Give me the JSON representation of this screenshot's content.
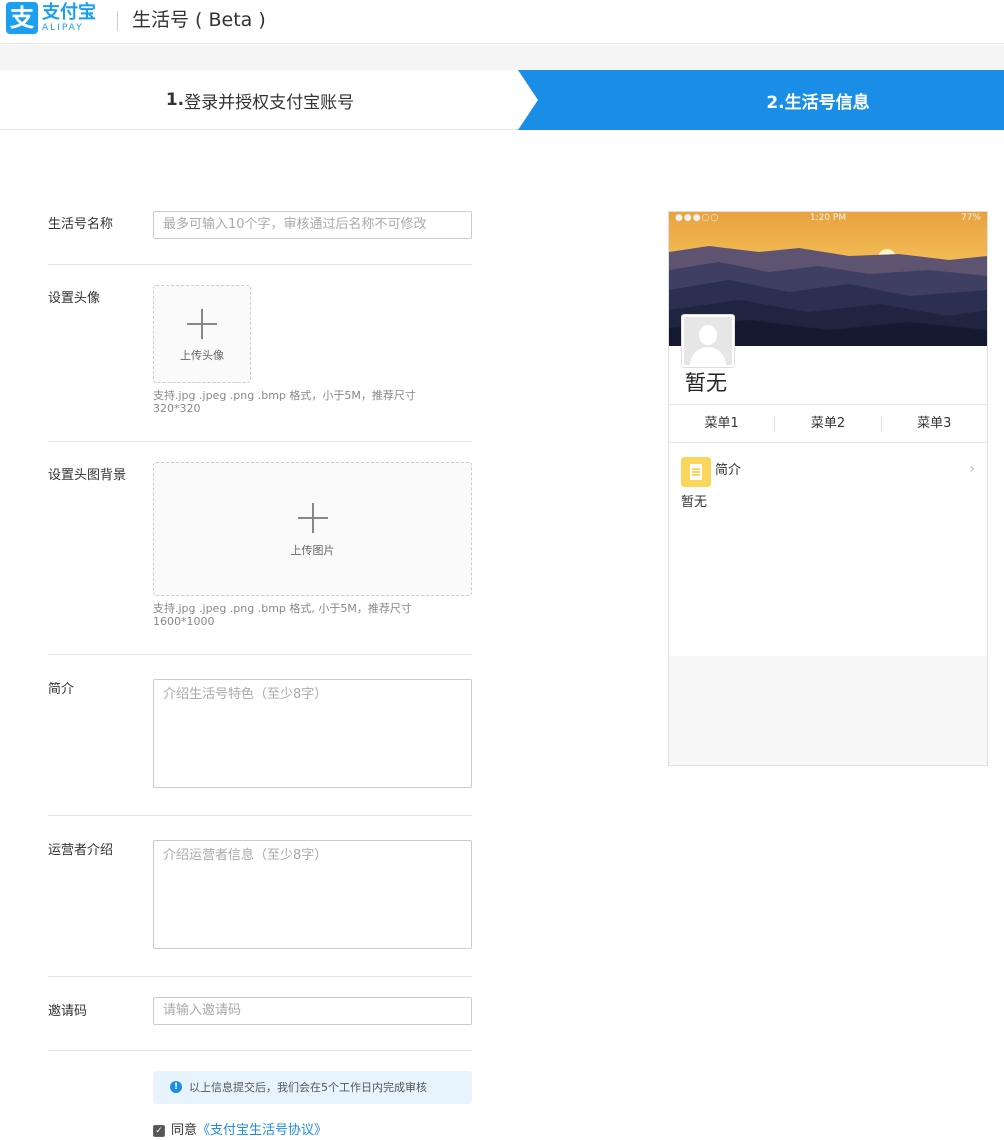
{
  "header": {
    "logo_cn": "支付宝",
    "logo_en": "ALIPAY",
    "logo_glyph": "支",
    "title": "生活号 ( Beta )"
  },
  "steps": {
    "step1_num": "1.",
    "step1_label": "登录并授权支付宝账号",
    "step2_label": "2.生活号信息"
  },
  "form": {
    "name_label": "生活号名称",
    "name_placeholder": "最多可输入10个字，审核通过后名称不可修改",
    "avatar_label": "设置头像",
    "avatar_upload": "上传头像",
    "avatar_hint": "支持.jpg .jpeg .png .bmp 格式，小于5M，推荐尺寸320*320",
    "bg_label": "设置头图背景",
    "bg_upload": "上传图片",
    "bg_hint": "支持.jpg .jpeg .png .bmp 格式, 小于5M，推荐尺寸1600*1000",
    "intro_label": "简介",
    "intro_placeholder": "介绍生活号特色（至少8字）",
    "operator_label": "运营者介绍",
    "operator_placeholder": "介绍运营者信息（至少8字）",
    "invite_label": "邀请码",
    "invite_placeholder": "请输入邀请码",
    "notice": "以上信息提交后，我们会在5个工作日内完成审核",
    "agree_prefix": "同意",
    "agree_link": "《支付宝生活号协议》"
  },
  "preview": {
    "status_signal": "●●●○○",
    "status_time": "1:20 PM",
    "status_battery": "77%",
    "name": "暂无",
    "menus": [
      "菜单1",
      "菜单2",
      "菜单3"
    ],
    "intro_title": "简介",
    "intro_text": "暂无"
  },
  "colors": {
    "brand": "#1a9ff1",
    "step_active": "#1a8ee6",
    "notice_bg": "#e8f4fd",
    "intro_icon": "#fbd65d"
  }
}
